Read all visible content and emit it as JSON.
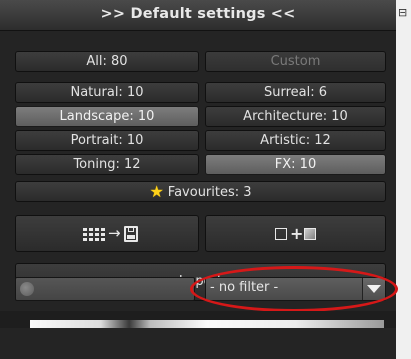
{
  "header": {
    "title": ">> Default settings <<"
  },
  "presets": {
    "all_label": "All: 80",
    "custom_label": "Custom",
    "natural_label": "Natural: 10",
    "surreal_label": "Surreal: 6",
    "landscape_label": "Landscape: 10",
    "architecture_label": "Architecture: 10",
    "portrait_label": "Portrait: 10",
    "artistic_label": "Artistic: 12",
    "toning_label": "Toning: 12",
    "fx_label": "FX: 10",
    "favourites_label": "Favourites: 3",
    "selected": [
      "Landscape: 10",
      "FX: 10"
    ]
  },
  "actions": {
    "import_label": "Import"
  },
  "filter": {
    "selected_value": "- no filter -"
  },
  "colors": {
    "annotation_ellipse": "#d61818",
    "favourite_star": "#ffd21a",
    "selected_button": "#6e6e6e"
  },
  "icons": {
    "save_preset": "grid-arrow-disk-icon",
    "combine": "square-plus-square-icon",
    "search": "search-dot-icon",
    "dropdown": "chevron-down-icon",
    "favourite": "star-icon"
  }
}
